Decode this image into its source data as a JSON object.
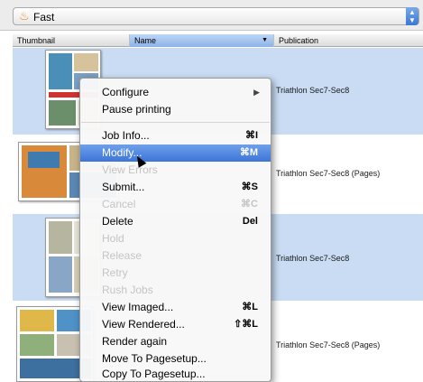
{
  "selector": {
    "icon": "flame-icon",
    "value": "Fast"
  },
  "columns": {
    "thumbnail": "Thumbnail",
    "name": "Name",
    "publication": "Publication"
  },
  "rows": [
    {
      "publication": "Triathlon Sec7-Sec8"
    },
    {
      "publication": "Triathlon Sec7-Sec8 (Pages)"
    },
    {
      "publication": "Triathlon Sec7-Sec8"
    },
    {
      "publication": "Triathlon Sec7-Sec8 (Pages)"
    }
  ],
  "menu": {
    "items": [
      {
        "label": "Configure",
        "shortcut": "",
        "submenu": true,
        "enabled": true
      },
      {
        "label": "Pause printing",
        "shortcut": "",
        "enabled": true
      },
      {
        "label": "Job Info...",
        "shortcut": "⌘I",
        "enabled": true
      },
      {
        "label": "Modify...",
        "shortcut": "⌘M",
        "enabled": true,
        "highlighted": true
      },
      {
        "label": "View Errors",
        "shortcut": "",
        "enabled": false
      },
      {
        "label": "Submit...",
        "shortcut": "⌘S",
        "enabled": true
      },
      {
        "label": "Cancel",
        "shortcut": "⌘C",
        "enabled": false
      },
      {
        "label": "Delete",
        "shortcut": "Del",
        "enabled": true
      },
      {
        "label": "Hold",
        "shortcut": "",
        "enabled": false
      },
      {
        "label": "Release",
        "shortcut": "",
        "enabled": false
      },
      {
        "label": "Retry",
        "shortcut": "",
        "enabled": false
      },
      {
        "label": "Rush Jobs",
        "shortcut": "",
        "enabled": false
      },
      {
        "label": "View Imaged...",
        "shortcut": "⌘L",
        "enabled": true
      },
      {
        "label": "View Rendered...",
        "shortcut": "⇧⌘L",
        "enabled": true
      },
      {
        "label": "Render again",
        "shortcut": "",
        "enabled": true
      },
      {
        "label": "Move To Pagesetup...",
        "shortcut": "",
        "enabled": true
      },
      {
        "label": "Copy To Pagesetup...",
        "shortcut": "",
        "enabled": true
      }
    ]
  },
  "colors": {
    "row_alt": "#c9dcf3",
    "highlight": "#3d74d8",
    "flame": "#e68a1e"
  }
}
